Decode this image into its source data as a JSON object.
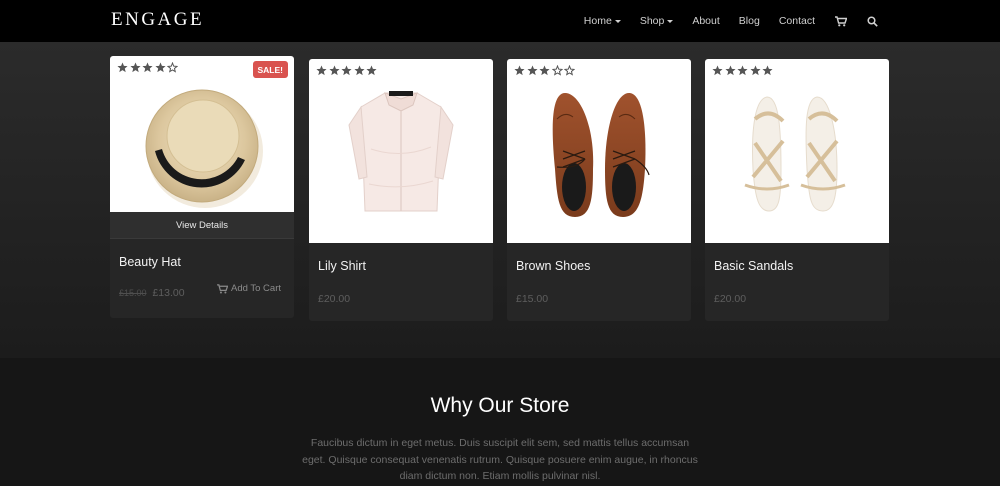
{
  "nav": {
    "brand": "ENGAGE",
    "links": [
      {
        "label": "Home",
        "dropdown": true
      },
      {
        "label": "Shop",
        "dropdown": true
      },
      {
        "label": "About",
        "dropdown": false
      },
      {
        "label": "Blog",
        "dropdown": false
      },
      {
        "label": "Contact",
        "dropdown": false
      }
    ],
    "icons": [
      "cart-icon",
      "search-icon"
    ]
  },
  "products": [
    {
      "name": "Beauty Hat",
      "rating": 4,
      "sale_badge": "SALE!",
      "old_price": "£15.00",
      "price": "£13.00",
      "view_details": "View Details",
      "add_to_cart": "Add To Cart"
    },
    {
      "name": "Lily Shirt",
      "rating": 5,
      "price": "£20.00"
    },
    {
      "name": "Brown Shoes",
      "rating": 3,
      "price": "£15.00"
    },
    {
      "name": "Basic Sandals",
      "rating": 5,
      "price": "£20.00"
    }
  ],
  "why": {
    "title": "Why Our Store",
    "text": "Faucibus dictum in eget metus. Duis suscipit elit sem, sed mattis tellus accumsan eget. Quisque consequat venenatis rutrum. Quisque posuere enim augue, in rhoncus diam dictum non. Etiam mollis pulvinar nisl."
  },
  "colors": {
    "nav_bg": "#000000",
    "sale_red": "#d9534f",
    "card_bg": "#262626",
    "star": "#555555"
  }
}
